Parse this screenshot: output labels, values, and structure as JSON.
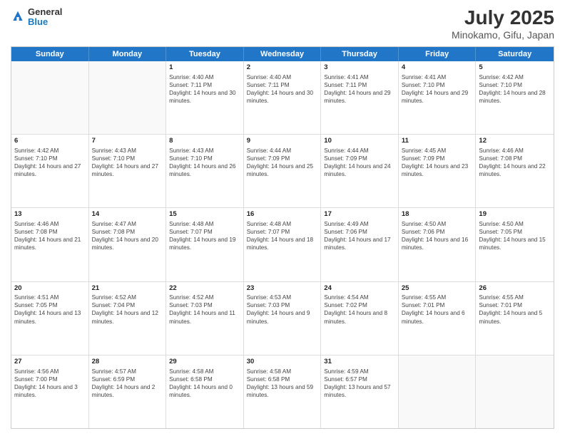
{
  "header": {
    "logo_line1": "General",
    "logo_line2": "Blue",
    "title": "July 2025",
    "subtitle": "Minokamo, Gifu, Japan"
  },
  "days_of_week": [
    "Sunday",
    "Monday",
    "Tuesday",
    "Wednesday",
    "Thursday",
    "Friday",
    "Saturday"
  ],
  "weeks": [
    [
      {
        "day": "",
        "sunrise": "",
        "sunset": "",
        "daylight": ""
      },
      {
        "day": "",
        "sunrise": "",
        "sunset": "",
        "daylight": ""
      },
      {
        "day": "1",
        "sunrise": "Sunrise: 4:40 AM",
        "sunset": "Sunset: 7:11 PM",
        "daylight": "Daylight: 14 hours and 30 minutes."
      },
      {
        "day": "2",
        "sunrise": "Sunrise: 4:40 AM",
        "sunset": "Sunset: 7:11 PM",
        "daylight": "Daylight: 14 hours and 30 minutes."
      },
      {
        "day": "3",
        "sunrise": "Sunrise: 4:41 AM",
        "sunset": "Sunset: 7:11 PM",
        "daylight": "Daylight: 14 hours and 29 minutes."
      },
      {
        "day": "4",
        "sunrise": "Sunrise: 4:41 AM",
        "sunset": "Sunset: 7:10 PM",
        "daylight": "Daylight: 14 hours and 29 minutes."
      },
      {
        "day": "5",
        "sunrise": "Sunrise: 4:42 AM",
        "sunset": "Sunset: 7:10 PM",
        "daylight": "Daylight: 14 hours and 28 minutes."
      }
    ],
    [
      {
        "day": "6",
        "sunrise": "Sunrise: 4:42 AM",
        "sunset": "Sunset: 7:10 PM",
        "daylight": "Daylight: 14 hours and 27 minutes."
      },
      {
        "day": "7",
        "sunrise": "Sunrise: 4:43 AM",
        "sunset": "Sunset: 7:10 PM",
        "daylight": "Daylight: 14 hours and 27 minutes."
      },
      {
        "day": "8",
        "sunrise": "Sunrise: 4:43 AM",
        "sunset": "Sunset: 7:10 PM",
        "daylight": "Daylight: 14 hours and 26 minutes."
      },
      {
        "day": "9",
        "sunrise": "Sunrise: 4:44 AM",
        "sunset": "Sunset: 7:09 PM",
        "daylight": "Daylight: 14 hours and 25 minutes."
      },
      {
        "day": "10",
        "sunrise": "Sunrise: 4:44 AM",
        "sunset": "Sunset: 7:09 PM",
        "daylight": "Daylight: 14 hours and 24 minutes."
      },
      {
        "day": "11",
        "sunrise": "Sunrise: 4:45 AM",
        "sunset": "Sunset: 7:09 PM",
        "daylight": "Daylight: 14 hours and 23 minutes."
      },
      {
        "day": "12",
        "sunrise": "Sunrise: 4:46 AM",
        "sunset": "Sunset: 7:08 PM",
        "daylight": "Daylight: 14 hours and 22 minutes."
      }
    ],
    [
      {
        "day": "13",
        "sunrise": "Sunrise: 4:46 AM",
        "sunset": "Sunset: 7:08 PM",
        "daylight": "Daylight: 14 hours and 21 minutes."
      },
      {
        "day": "14",
        "sunrise": "Sunrise: 4:47 AM",
        "sunset": "Sunset: 7:08 PM",
        "daylight": "Daylight: 14 hours and 20 minutes."
      },
      {
        "day": "15",
        "sunrise": "Sunrise: 4:48 AM",
        "sunset": "Sunset: 7:07 PM",
        "daylight": "Daylight: 14 hours and 19 minutes."
      },
      {
        "day": "16",
        "sunrise": "Sunrise: 4:48 AM",
        "sunset": "Sunset: 7:07 PM",
        "daylight": "Daylight: 14 hours and 18 minutes."
      },
      {
        "day": "17",
        "sunrise": "Sunrise: 4:49 AM",
        "sunset": "Sunset: 7:06 PM",
        "daylight": "Daylight: 14 hours and 17 minutes."
      },
      {
        "day": "18",
        "sunrise": "Sunrise: 4:50 AM",
        "sunset": "Sunset: 7:06 PM",
        "daylight": "Daylight: 14 hours and 16 minutes."
      },
      {
        "day": "19",
        "sunrise": "Sunrise: 4:50 AM",
        "sunset": "Sunset: 7:05 PM",
        "daylight": "Daylight: 14 hours and 15 minutes."
      }
    ],
    [
      {
        "day": "20",
        "sunrise": "Sunrise: 4:51 AM",
        "sunset": "Sunset: 7:05 PM",
        "daylight": "Daylight: 14 hours and 13 minutes."
      },
      {
        "day": "21",
        "sunrise": "Sunrise: 4:52 AM",
        "sunset": "Sunset: 7:04 PM",
        "daylight": "Daylight: 14 hours and 12 minutes."
      },
      {
        "day": "22",
        "sunrise": "Sunrise: 4:52 AM",
        "sunset": "Sunset: 7:03 PM",
        "daylight": "Daylight: 14 hours and 11 minutes."
      },
      {
        "day": "23",
        "sunrise": "Sunrise: 4:53 AM",
        "sunset": "Sunset: 7:03 PM",
        "daylight": "Daylight: 14 hours and 9 minutes."
      },
      {
        "day": "24",
        "sunrise": "Sunrise: 4:54 AM",
        "sunset": "Sunset: 7:02 PM",
        "daylight": "Daylight: 14 hours and 8 minutes."
      },
      {
        "day": "25",
        "sunrise": "Sunrise: 4:55 AM",
        "sunset": "Sunset: 7:01 PM",
        "daylight": "Daylight: 14 hours and 6 minutes."
      },
      {
        "day": "26",
        "sunrise": "Sunrise: 4:55 AM",
        "sunset": "Sunset: 7:01 PM",
        "daylight": "Daylight: 14 hours and 5 minutes."
      }
    ],
    [
      {
        "day": "27",
        "sunrise": "Sunrise: 4:56 AM",
        "sunset": "Sunset: 7:00 PM",
        "daylight": "Daylight: 14 hours and 3 minutes."
      },
      {
        "day": "28",
        "sunrise": "Sunrise: 4:57 AM",
        "sunset": "Sunset: 6:59 PM",
        "daylight": "Daylight: 14 hours and 2 minutes."
      },
      {
        "day": "29",
        "sunrise": "Sunrise: 4:58 AM",
        "sunset": "Sunset: 6:58 PM",
        "daylight": "Daylight: 14 hours and 0 minutes."
      },
      {
        "day": "30",
        "sunrise": "Sunrise: 4:58 AM",
        "sunset": "Sunset: 6:58 PM",
        "daylight": "Daylight: 13 hours and 59 minutes."
      },
      {
        "day": "31",
        "sunrise": "Sunrise: 4:59 AM",
        "sunset": "Sunset: 6:57 PM",
        "daylight": "Daylight: 13 hours and 57 minutes."
      },
      {
        "day": "",
        "sunrise": "",
        "sunset": "",
        "daylight": ""
      },
      {
        "day": "",
        "sunrise": "",
        "sunset": "",
        "daylight": ""
      }
    ]
  ]
}
